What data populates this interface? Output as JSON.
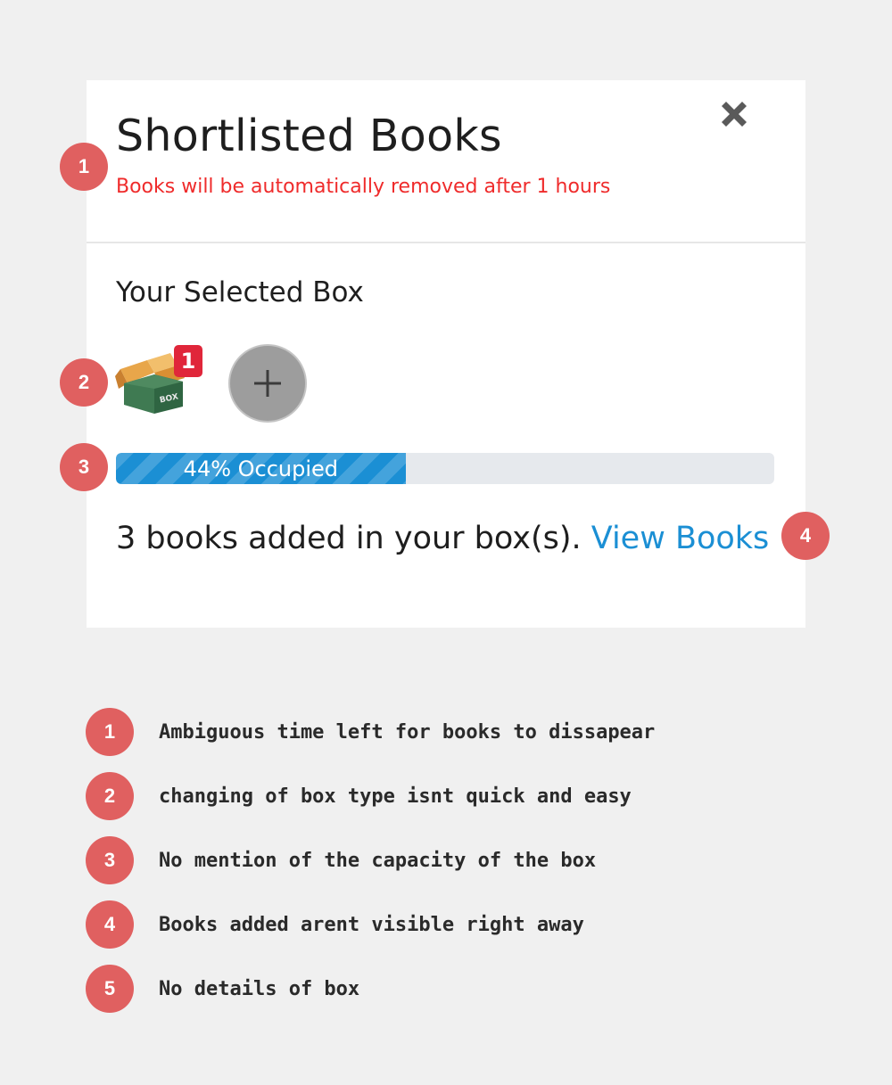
{
  "panel": {
    "title": "Shortlisted Books",
    "subtitle": "Books will be automatically removed after 1 hours",
    "close_icon": "close-icon",
    "section_title": "Your Selected Box",
    "box": {
      "icon": "cardboard-box-icon",
      "label": "BOX",
      "badge_count": "1"
    },
    "add_box_icon": "plus-icon",
    "progress": {
      "label": "44% Occupied",
      "percent": 44
    },
    "books_text": "3 books added in your box(s).",
    "view_books_label": "View Books"
  },
  "markers": [
    {
      "number": "1"
    },
    {
      "number": "2"
    },
    {
      "number": "3"
    },
    {
      "number": "4"
    }
  ],
  "notes": [
    {
      "number": "1",
      "text": "Ambiguous time left for books to dissapear"
    },
    {
      "number": "2",
      "text": "changing of box type isnt quick and easy"
    },
    {
      "number": "3",
      "text": "No mention of the capacity of the box"
    },
    {
      "number": "4",
      "text": "Books added arent visible right away"
    },
    {
      "number": "5",
      "text": "No details of box"
    }
  ],
  "colors": {
    "background": "#f0f0f0",
    "subtitle_red": "#ef2b2b",
    "accent_blue": "#1b8fd4",
    "marker_red": "#e06060",
    "badge_red": "#e0263a"
  }
}
